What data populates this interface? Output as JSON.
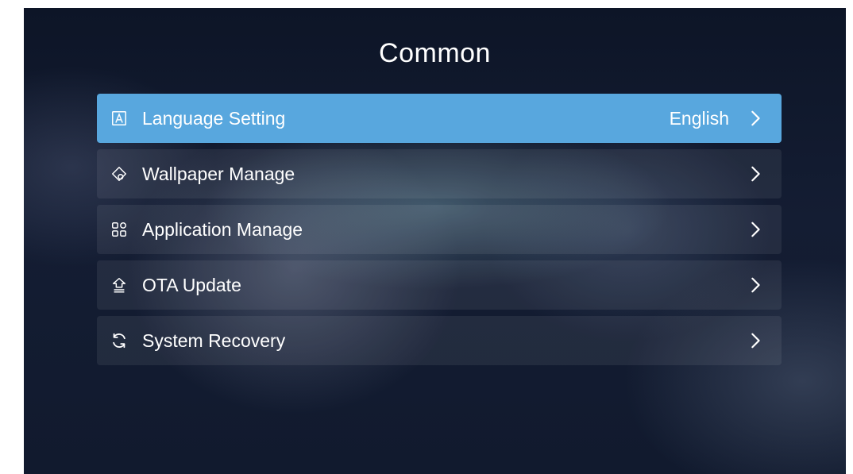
{
  "screen": {
    "title": "Common"
  },
  "menu": {
    "items": [
      {
        "label": "Language Setting",
        "value": "English",
        "icon": "language-icon",
        "selected": true
      },
      {
        "label": "Wallpaper Manage",
        "value": "",
        "icon": "wallpaper-icon",
        "selected": false
      },
      {
        "label": "Application Manage",
        "value": "",
        "icon": "apps-icon",
        "selected": false
      },
      {
        "label": "OTA Update",
        "value": "",
        "icon": "ota-update-icon",
        "selected": false
      },
      {
        "label": "System Recovery",
        "value": "",
        "icon": "recovery-icon",
        "selected": false
      }
    ]
  },
  "colors": {
    "accent": "#58a7de",
    "background": "#121b30",
    "text": "#ffffff"
  }
}
